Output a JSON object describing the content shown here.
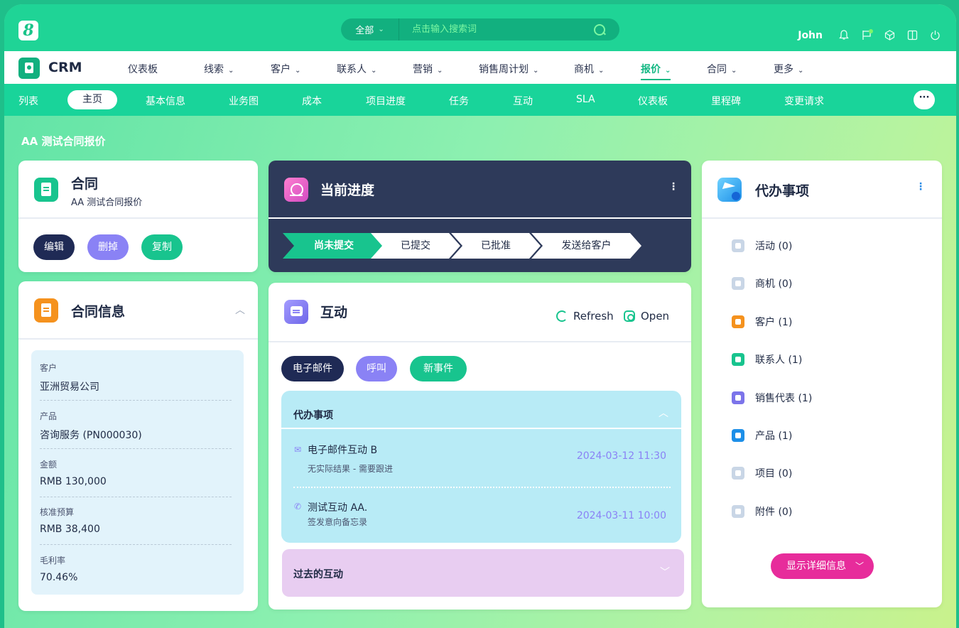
{
  "topbar": {
    "logo": "8",
    "search_scope": "全部",
    "search_placeholder": "点击输入搜索词",
    "user_name": "John"
  },
  "modnav": {
    "app_title": "CRM",
    "items": [
      {
        "label": "仪表板",
        "has_menu": false
      },
      {
        "label": "线索",
        "has_menu": true
      },
      {
        "label": "客户",
        "has_menu": true
      },
      {
        "label": "联系人",
        "has_menu": true
      },
      {
        "label": "营销",
        "has_menu": true
      },
      {
        "label": "销售周计划",
        "has_menu": true
      },
      {
        "label": "商机",
        "has_menu": true
      },
      {
        "label": "报价",
        "has_menu": true,
        "active": true
      },
      {
        "label": "合同",
        "has_menu": true
      },
      {
        "label": "更多",
        "has_menu": true
      }
    ]
  },
  "subnav": {
    "items": [
      "列表",
      "主页",
      "基本信息",
      "业务图",
      "成本",
      "项目进度",
      "任务",
      "互动",
      "SLA",
      "仪表板",
      "里程碑",
      "变更请求"
    ],
    "active": "主页",
    "more_label": "···"
  },
  "page": {
    "title": "AA 测试合同报价"
  },
  "contract_card": {
    "title": "合同",
    "subtitle": "AA 测试合同报价",
    "buttons": {
      "edit": "编辑",
      "delete": "删掉",
      "copy": "复制"
    }
  },
  "contract_info": {
    "title": "合同信息",
    "fields": [
      {
        "label": "客户",
        "value": "亚洲贸易公司"
      },
      {
        "label": "产品",
        "value": "咨询服务 (PN000030)"
      },
      {
        "label": "金额",
        "value": "RMB 130,000"
      },
      {
        "label": "核准预算",
        "value": "RMB 38,400"
      },
      {
        "label": "毛利率",
        "value": "70.46%"
      }
    ]
  },
  "progress_card": {
    "title": "当前进度",
    "stages": [
      "尚未提交",
      "已提交",
      "已批准",
      "发送给客户"
    ],
    "current": "尚未提交"
  },
  "interaction_card": {
    "title": "互动",
    "refresh_label": "Refresh",
    "open_label": "Open",
    "tabs": {
      "email": "电子邮件",
      "call": "呼叫",
      "event": "新事件"
    },
    "todo": {
      "title": "代办事项",
      "items": [
        {
          "title": "电子邮件互动 B",
          "subtitle": "无实际结果 - 需要跟进",
          "date": "2024-03-12 11:30"
        },
        {
          "title": "测试互动 AA.",
          "subtitle": "签发意向备忘录",
          "date": "2024-03-11 10:00"
        }
      ]
    },
    "past": {
      "title": "过去的互动"
    }
  },
  "todo_card": {
    "title": "代办事项",
    "items": [
      {
        "label": "活动 (0)",
        "color": "#c9d6e6"
      },
      {
        "label": "商机 (0)",
        "color": "#c9d6e6"
      },
      {
        "label": "客户 (1)",
        "color": "#f5921e"
      },
      {
        "label": "联系人 (1)",
        "color": "#18c48e"
      },
      {
        "label": "销售代表 (1)",
        "color": "#7c74ea"
      },
      {
        "label": "产品 (1)",
        "color": "#1d8fe8"
      },
      {
        "label": "项目 (0)",
        "color": "#c9d6e6"
      },
      {
        "label": "附件 (0)",
        "color": "#c9d6e6"
      }
    ],
    "detail_button": "显示详细信息"
  },
  "colors": {
    "brand_green": "#1fd496",
    "dark_panel": "#2e3a5a",
    "accent_pink": "#e72c9b",
    "violet": "#8a82f5"
  }
}
